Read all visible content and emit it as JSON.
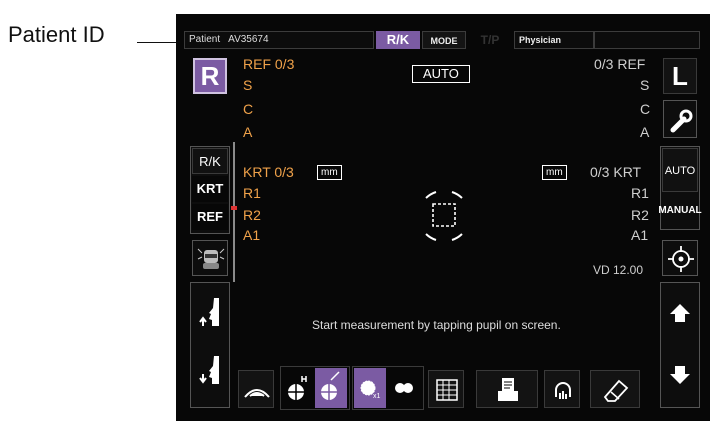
{
  "callout": {
    "label": "Patient ID"
  },
  "topbar": {
    "patient_label": "Patient",
    "patient_id": "AV35674",
    "rk_label": "R/K",
    "mode_label": "MODE",
    "tp_label": "T/P",
    "physician_label": "Physician"
  },
  "right_eye": {
    "letter": "R",
    "ref_label": "REF 0/3",
    "s": "S",
    "c": "C",
    "a": "A",
    "krt_label": "KRT 0/3",
    "r1": "R1",
    "r2": "R2",
    "a1": "A1"
  },
  "left_eye": {
    "letter": "L",
    "ref_label": "0/3 REF",
    "s": "S",
    "c": "C",
    "a": "A",
    "krt_label": "0/3 KRT",
    "r1": "R1",
    "r2": "R2",
    "a1": "A1"
  },
  "auto_badge": "AUTO",
  "mm_left": "mm",
  "mm_right": "mm",
  "vd_label": "VD 12.00",
  "side_left": {
    "rk": "R/K",
    "krt": "KRT",
    "ref": "REF"
  },
  "side_right": {
    "auto": "AUTO",
    "manual": "MANUAL"
  },
  "instruction": "Start measurement by tapping pupil on screen.",
  "icons": [
    "wrench-icon",
    "face-camera-icon",
    "head-up-icon",
    "head-down-icon",
    "crosshair-icon",
    "arrow-up-icon",
    "arrow-down-icon",
    "eye-icon",
    "chart-icon",
    "pupil-mode-icon",
    "table-icon",
    "print-icon",
    "hand-gauge-icon",
    "eraser-icon"
  ],
  "colors": {
    "accent": "#7b5ba3",
    "orange": "#f0a24a",
    "background": "#070707"
  }
}
